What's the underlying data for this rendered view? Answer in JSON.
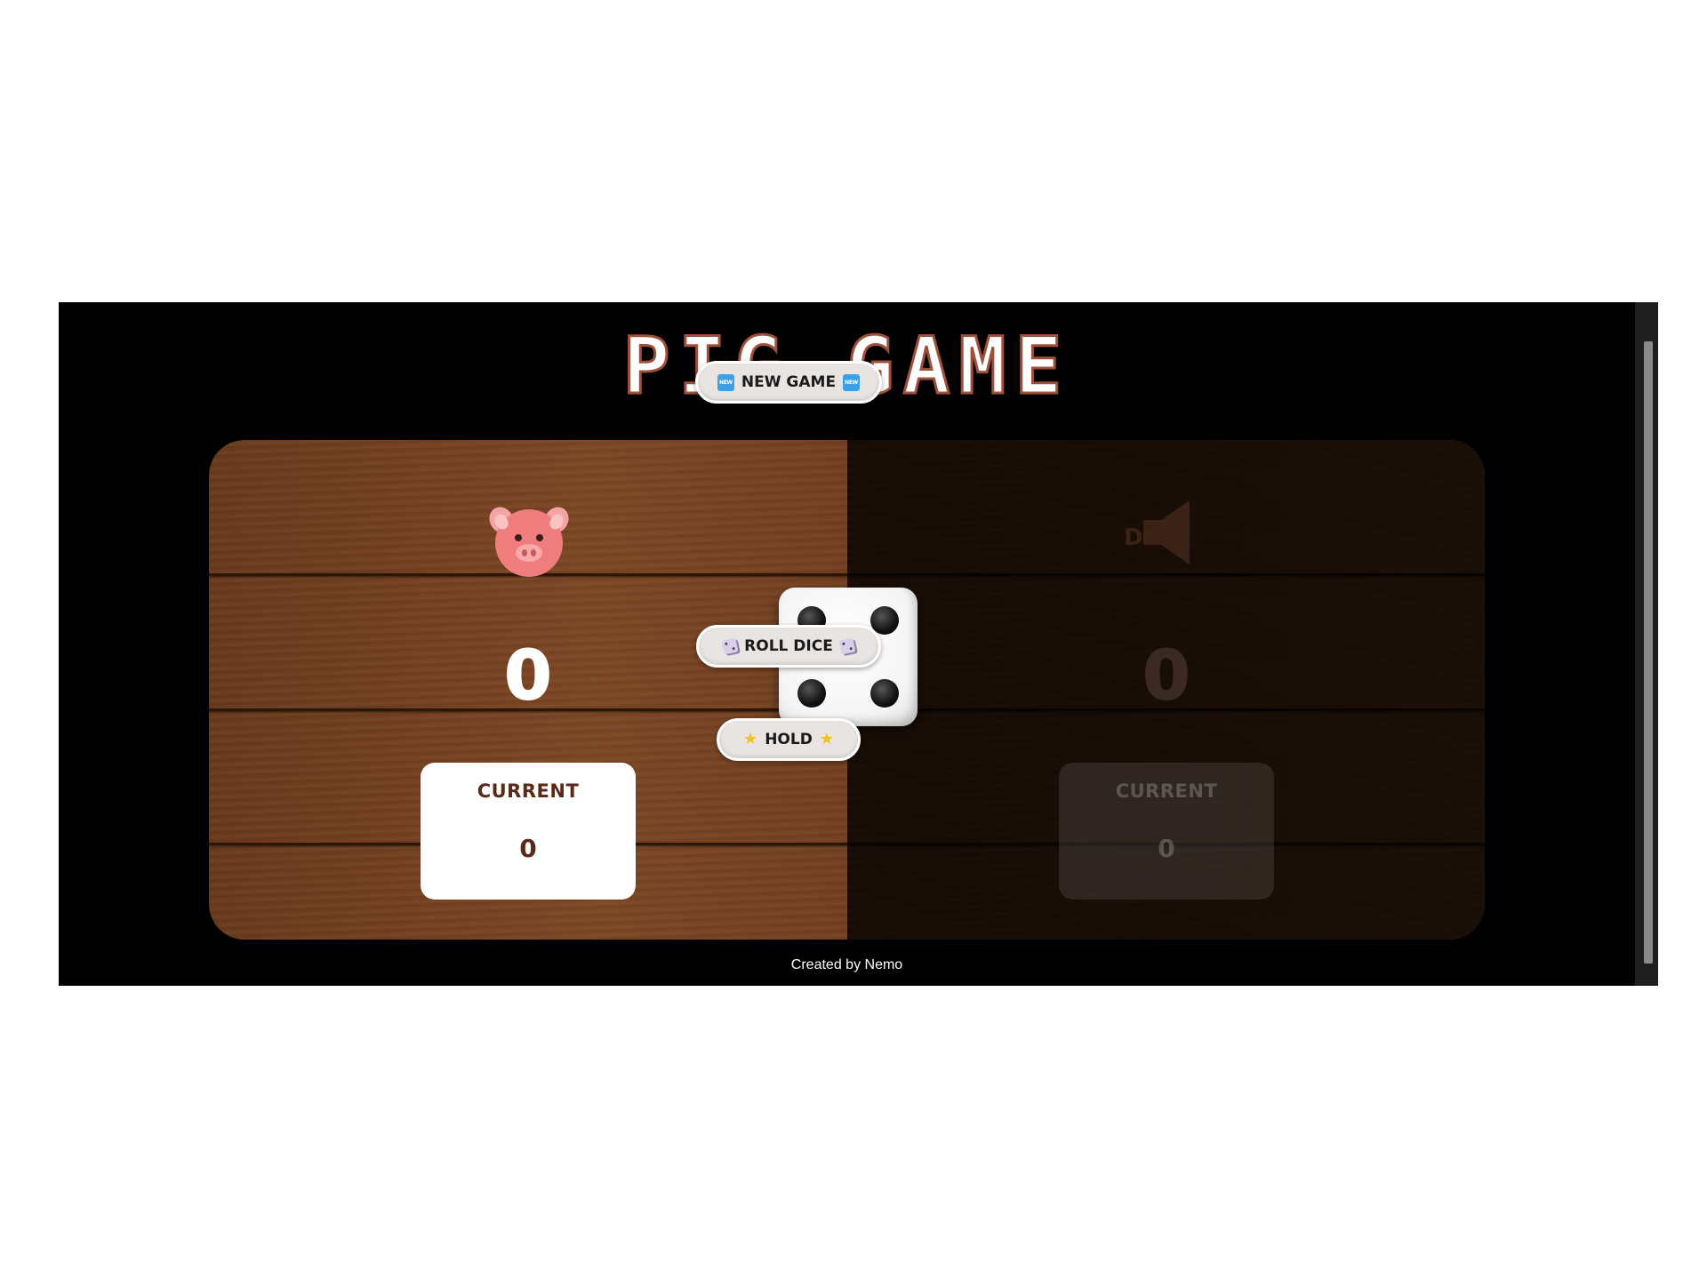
{
  "title": "PIG GAME",
  "players": [
    {
      "score": "0",
      "current_label": "CURRENT",
      "current_score": "0",
      "avatar": "pig-icon",
      "active": true
    },
    {
      "score": "0",
      "current_label": "CURRENT",
      "current_score": "0",
      "avatar": "speaker-icon",
      "active": false
    }
  ],
  "buttons": {
    "new_game": "NEW GAME",
    "roll_dice": "ROLL DICE",
    "hold": "HOLD"
  },
  "dice": {
    "value": 4
  },
  "footer": "Created by Nemo",
  "colors": {
    "background": "#000000",
    "title_outline": "#a0503a",
    "wood": "#7d4725",
    "current_text": "#5a2a16"
  }
}
